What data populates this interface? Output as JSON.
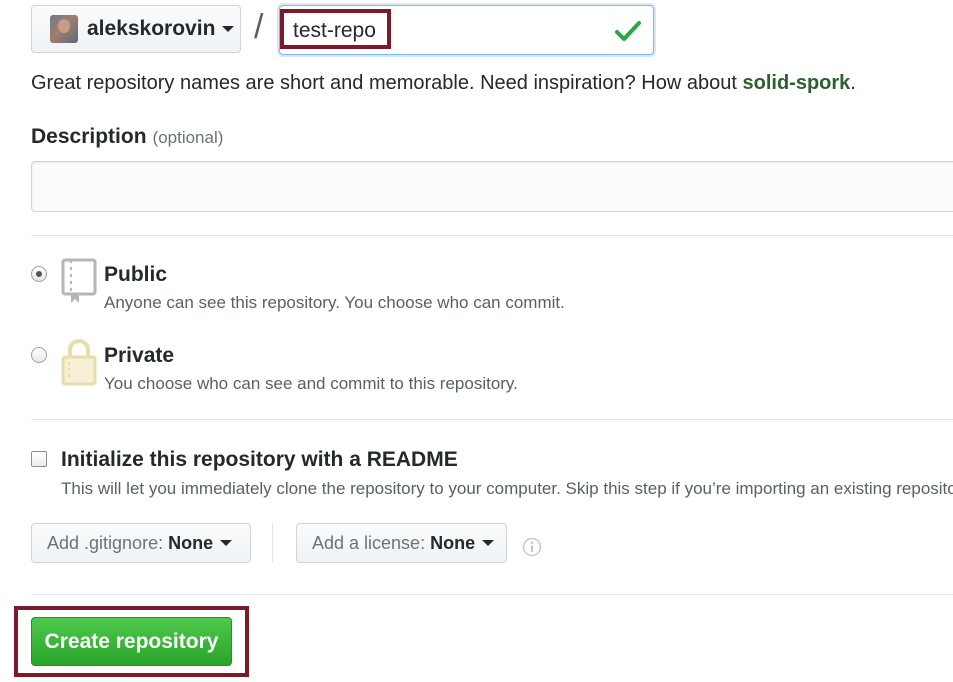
{
  "owner": {
    "name": "alekskorovin"
  },
  "repo_separator": "/",
  "repo_name": {
    "value": "test-repo",
    "status_icon": "check-icon",
    "status_color": "#28a745"
  },
  "hint": {
    "prefix": "Great repository names are short and memorable. Need inspiration? How about ",
    "suggestion": "solid-spork",
    "suffix": "."
  },
  "description": {
    "label": "Description",
    "optional": "(optional)",
    "value": ""
  },
  "visibility": {
    "public": {
      "title": "Public",
      "note": "Anyone can see this repository. You choose who can commit.",
      "icon": "book-icon",
      "selected": true
    },
    "private": {
      "title": "Private",
      "note": "You choose who can see and commit to this repository.",
      "icon": "lock-icon",
      "selected": false
    }
  },
  "init_readme": {
    "title": "Initialize this repository with a README",
    "note": "This will let you immediately clone the repository to your computer. Skip this step if you’re importing an existing repository.",
    "checked": false
  },
  "gitignore": {
    "label": "Add .gitignore:",
    "value": "None"
  },
  "license": {
    "label": "Add a license:",
    "value": "None",
    "info_icon": "info-icon"
  },
  "create_button": {
    "label": "Create repository",
    "color": "#28a745"
  },
  "annotation_color": "#7b1b2a"
}
